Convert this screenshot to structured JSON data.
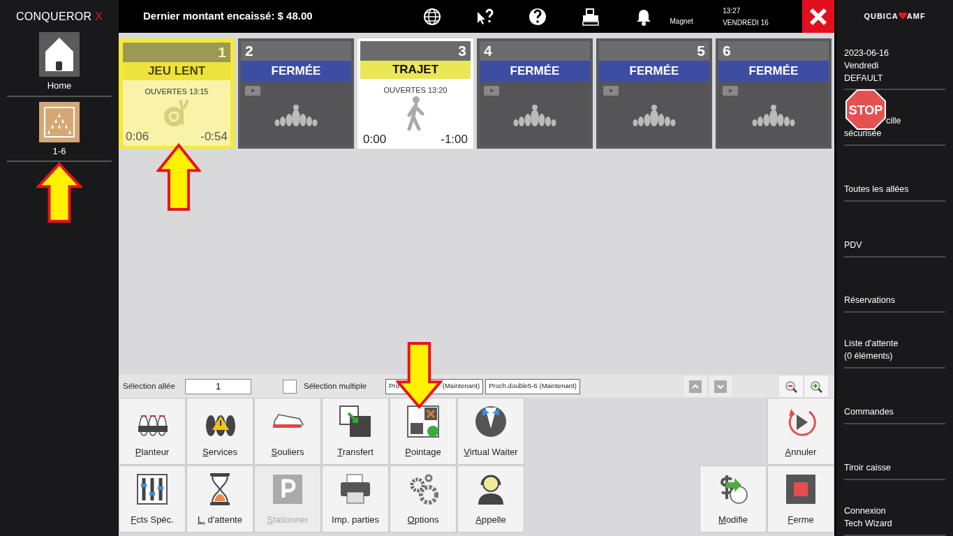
{
  "sidebar_left": {
    "brand": "CONQUEROR",
    "brand_mark": "X",
    "items": [
      {
        "label": "Home"
      },
      {
        "label": "1-6"
      }
    ]
  },
  "top_bar": {
    "last_amount": "Dernier montant encaissé: $ 48.00",
    "user": "Magnet",
    "time": "13:27",
    "day": "VENDREDI 16"
  },
  "lanes": [
    {
      "number": "1",
      "number_right": true,
      "kind": "slow",
      "selected": true,
      "status": "JEU LENT",
      "opened": "OUVERTES 13:15",
      "elapsed": "0:06",
      "remaining": "-0:54"
    },
    {
      "number": "2",
      "number_right": false,
      "kind": "closed",
      "selected": false,
      "status": "FERMÉE"
    },
    {
      "number": "3",
      "number_right": true,
      "kind": "travel",
      "selected": false,
      "status": "TRAJET",
      "opened": "OUVERTES 13:20",
      "elapsed": "0:00",
      "remaining": "-1:00"
    },
    {
      "number": "4",
      "number_right": false,
      "kind": "closed",
      "selected": false,
      "status": "FERMÉE"
    },
    {
      "number": "5",
      "number_right": true,
      "kind": "closed",
      "selected": false,
      "status": "FERMÉE"
    },
    {
      "number": "6",
      "number_right": false,
      "kind": "closed",
      "selected": false,
      "status": "FERMÉE"
    }
  ],
  "toolbar": {
    "lane_label": "Sélection allée",
    "lane_value": "1",
    "multi_label": "Sélection multiple",
    "multi_checked": false,
    "next_buttons": [
      {
        "label_parts": [
          "Pro",
          "(Maintenant)"
        ]
      },
      {
        "label_parts": [
          "Proch.double5-6 (Maintenant)"
        ]
      }
    ]
  },
  "actions": [
    {
      "label": "Planteur",
      "underline": true,
      "disabled": false
    },
    {
      "label": "Services",
      "underline": true,
      "disabled": false
    },
    {
      "label": "Souliers",
      "underline": true,
      "disabled": false
    },
    {
      "label": "Transfert",
      "underline": true,
      "disabled": false
    },
    {
      "label": "Pointage",
      "underline": true,
      "disabled": false
    },
    {
      "label": "Virtual Waiter",
      "underline": true,
      "disabled": false
    },
    {
      "label": "Fcts Spéc.",
      "underline": true,
      "disabled": false
    },
    {
      "label": "L. d'attente",
      "underline": true,
      "disabled": false
    },
    {
      "label": "Stationner",
      "underline": true,
      "disabled": true
    },
    {
      "label": "Imp. parties",
      "underline": false,
      "disabled": false
    },
    {
      "label": "Options",
      "underline": true,
      "disabled": false
    },
    {
      "label": "Appelle",
      "underline": true,
      "disabled": false
    }
  ],
  "side_actions": [
    {
      "label": "Annuler"
    },
    {
      "label": "Modifie"
    },
    {
      "label": "Ferme"
    }
  ],
  "sidebar_right": {
    "logo_left": "QUBICA",
    "logo_right": "AMF",
    "date": "2023-06-16",
    "weekday": "Vendredi",
    "profile": "DEFAULT",
    "items": [
      {
        "lines": [
          "cille",
          "sécurisée"
        ]
      },
      {
        "lines": [
          "Toutes les allées"
        ]
      },
      {
        "lines": [
          "PDV"
        ]
      },
      {
        "lines": [
          "Réservations"
        ]
      },
      {
        "lines": [
          "Liste d'attente",
          "(0 éléments)"
        ]
      },
      {
        "lines": [
          "Commandes"
        ]
      },
      {
        "lines": [
          "Tiroir caisse"
        ]
      },
      {
        "lines": [
          "Connexion",
          "Tech Wizard"
        ]
      }
    ]
  },
  "annotations": [
    {
      "kind": "arrow",
      "pointing_up": true
    },
    {
      "kind": "arrow",
      "pointing_up": true
    },
    {
      "kind": "arrow",
      "pointing_up": false
    },
    {
      "kind": "stop-sign",
      "text": "STOP"
    }
  ]
}
